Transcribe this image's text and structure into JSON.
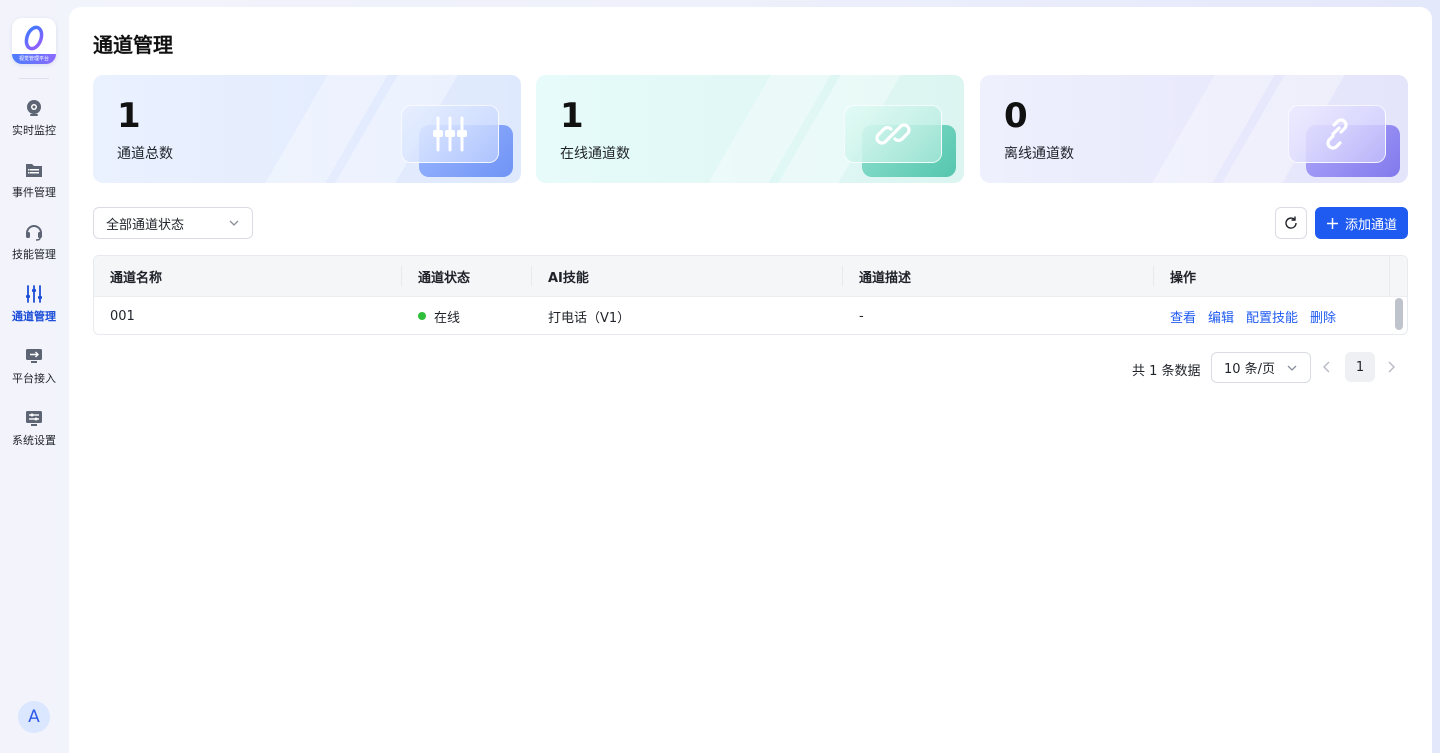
{
  "sidebar": {
    "logo_band": "视觉管理平台",
    "items": [
      {
        "label": "实时监控",
        "icon": "camera-icon",
        "active": false
      },
      {
        "label": "事件管理",
        "icon": "folder-list-icon",
        "active": false
      },
      {
        "label": "技能管理",
        "icon": "headset-icon",
        "active": false
      },
      {
        "label": "通道管理",
        "icon": "sliders-icon",
        "active": true
      },
      {
        "label": "平台接入",
        "icon": "monitor-arrow-icon",
        "active": false
      },
      {
        "label": "系统设置",
        "icon": "settings-panel-icon",
        "active": false
      }
    ],
    "avatar_initial": "A"
  },
  "page": {
    "title": "通道管理"
  },
  "stats": [
    {
      "value": "1",
      "label": "通道总数",
      "icon": "sliders-icon",
      "color": "#5b8cf6"
    },
    {
      "value": "1",
      "label": "在线通道数",
      "icon": "link-icon",
      "color": "#3ccab1"
    },
    {
      "value": "0",
      "label": "离线通道数",
      "icon": "broken-link-icon",
      "color": "#8a84f2"
    }
  ],
  "toolbar": {
    "filter_value": "全部通道状态",
    "add_label": "添加通道"
  },
  "table": {
    "columns": [
      "通道名称",
      "通道状态",
      "AI技能",
      "通道描述",
      "操作"
    ],
    "rows": [
      {
        "name": "001",
        "status": "在线",
        "skill": "打电话（V1）",
        "desc": "-",
        "actions": [
          "查看",
          "编辑",
          "配置技能",
          "删除"
        ]
      }
    ]
  },
  "pagination": {
    "total_text": "共 1 条数据",
    "page_size": "10 条/页",
    "current_page": "1"
  },
  "colors": {
    "primary": "#1f5bf0",
    "online": "#2fbf3a"
  }
}
